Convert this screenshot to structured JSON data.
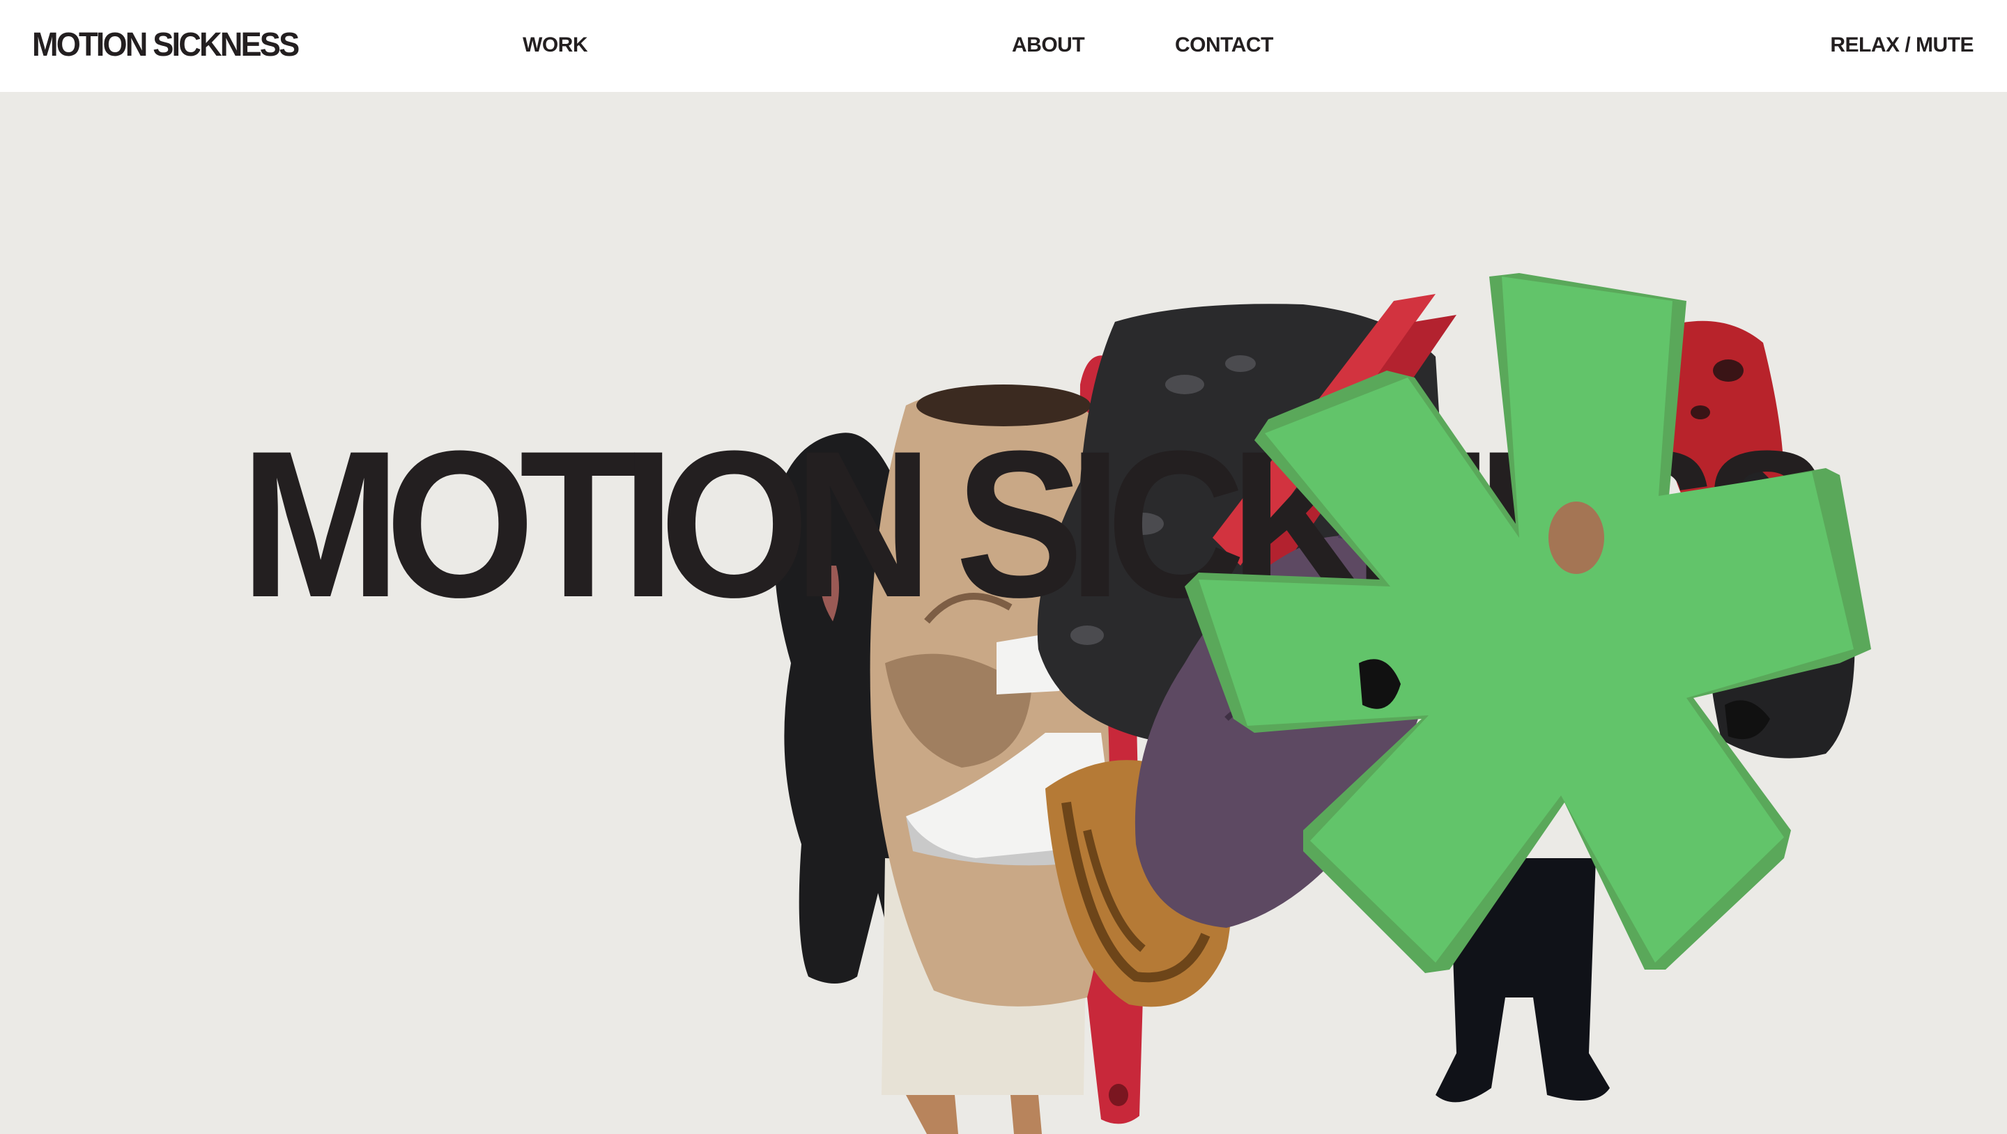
{
  "header": {
    "logo": "MOTION SICKNESS",
    "nav": {
      "work": "WORK",
      "about": "ABOUT",
      "contact": "CONTACT",
      "relax": "RELAX / MUTE"
    }
  },
  "hero": {
    "title": "MOTION SICKNESS"
  },
  "colors": {
    "background": "#ebeae6",
    "header_bg": "#ffffff",
    "text": "#231f20",
    "asterisk_green": "#62c46a",
    "accent_red": "#c8283a"
  }
}
